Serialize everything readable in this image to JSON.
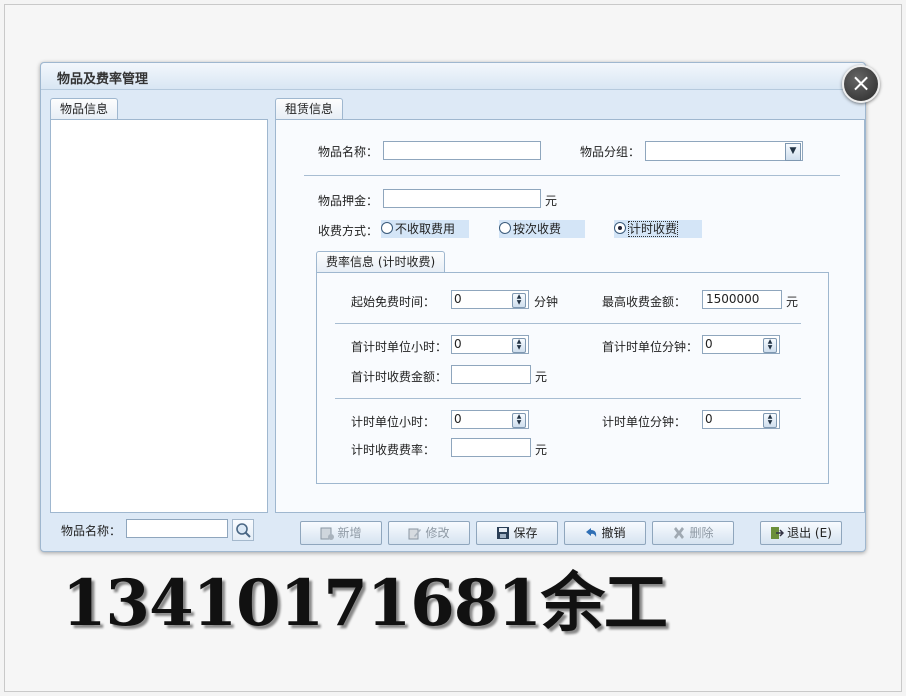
{
  "window": {
    "title": "物品及费率管理"
  },
  "left_panel": {
    "tab": "物品信息",
    "search_label": "物品名称：",
    "search_value": ""
  },
  "right_panel": {
    "tab": "租赁信息",
    "item_name_label": "物品名称：",
    "item_name_value": "",
    "item_group_label": "物品分组：",
    "item_group_value": "",
    "deposit_label": "物品押金：",
    "deposit_value": "",
    "deposit_unit": "元",
    "charge_mode_label": "收费方式：",
    "charge_modes": [
      "不收取费用",
      "按次收费",
      "计时收费"
    ],
    "charge_mode_selected": "计时收费"
  },
  "rate_panel": {
    "tab": "费率信息 (计时收费)",
    "free_time_label": "起始免费时间：",
    "free_time_value": "0",
    "free_time_unit": "分钟",
    "max_fee_label": "最高收费金额：",
    "max_fee_value": "1500000",
    "max_fee_unit": "元",
    "first_unit_hours_label": "首计时单位小时：",
    "first_unit_hours_value": "0",
    "first_unit_minutes_label": "首计时单位分钟：",
    "first_unit_minutes_value": "0",
    "first_fee_label": "首计时收费金额：",
    "first_fee_value": "",
    "first_fee_unit": "元",
    "unit_hours_label": "计时单位小时：",
    "unit_hours_value": "0",
    "unit_minutes_label": "计时单位分钟：",
    "unit_minutes_value": "0",
    "rate_label": "计时收费费率：",
    "rate_value": "",
    "rate_unit": "元"
  },
  "toolbar": {
    "add": "新增",
    "edit": "修改",
    "save": "保存",
    "undo": "撤销",
    "delete": "删除",
    "exit": "退出 (E)"
  },
  "overlay_text": "13410171681余工",
  "colors": {
    "window_bg": "#dde9f6",
    "border": "#9fb7cf",
    "button_bg": "#d6e3f0"
  }
}
